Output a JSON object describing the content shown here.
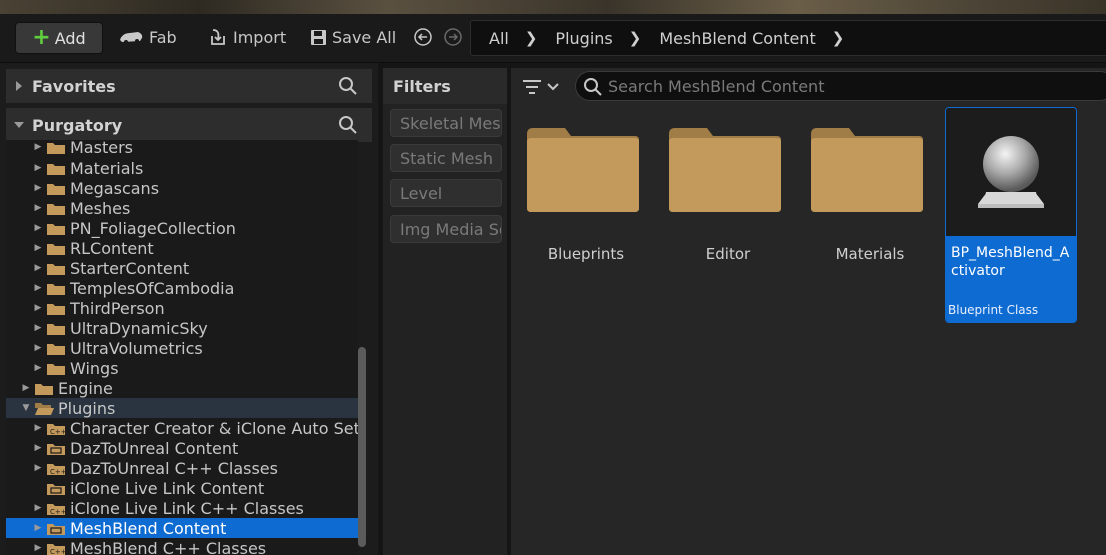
{
  "toolbar": {
    "add_label": "Add",
    "fab_label": "Fab",
    "import_label": "Import",
    "save_all_label": "Save All"
  },
  "breadcrumb": [
    "All",
    "Plugins",
    "MeshBlend Content"
  ],
  "sections": {
    "favorites": "Favorites",
    "project": "Purgatory"
  },
  "tree": [
    {
      "label": "Masters",
      "level": 2,
      "type": "folder"
    },
    {
      "label": "Materials",
      "level": 2,
      "type": "folder"
    },
    {
      "label": "Megascans",
      "level": 2,
      "type": "folder"
    },
    {
      "label": "Meshes",
      "level": 2,
      "type": "folder"
    },
    {
      "label": "PN_FoliageCollection",
      "level": 2,
      "type": "folder"
    },
    {
      "label": "RLContent",
      "level": 2,
      "type": "folder"
    },
    {
      "label": "StarterContent",
      "level": 2,
      "type": "folder"
    },
    {
      "label": "TemplesOfCambodia",
      "level": 2,
      "type": "folder"
    },
    {
      "label": "ThirdPerson",
      "level": 2,
      "type": "folder"
    },
    {
      "label": "UltraDynamicSky",
      "level": 2,
      "type": "folder"
    },
    {
      "label": "UltraVolumetrics",
      "level": 2,
      "type": "folder"
    },
    {
      "label": "Wings",
      "level": 2,
      "type": "folder"
    },
    {
      "label": "Engine",
      "level": 1,
      "type": "folder"
    },
    {
      "label": "Plugins",
      "level": 1,
      "type": "open-folder"
    },
    {
      "label": "Character Creator & iClone Auto Setup",
      "level": 2,
      "type": "cpp"
    },
    {
      "label": "DazToUnreal Content",
      "level": 2,
      "type": "content"
    },
    {
      "label": "DazToUnreal C++ Classes",
      "level": 2,
      "type": "cpp"
    },
    {
      "label": "iClone Live Link Content",
      "level": 2,
      "type": "content"
    },
    {
      "label": "iClone Live Link C++ Classes",
      "level": 2,
      "type": "cpp"
    },
    {
      "label": "MeshBlend Content",
      "level": 2,
      "type": "content"
    },
    {
      "label": "MeshBlend C++ Classes",
      "level": 2,
      "type": "cpp"
    }
  ],
  "filters": {
    "title": "Filters",
    "chips": [
      "Skeletal Mesh",
      "Static Mesh",
      "Level",
      "Img Media Source"
    ]
  },
  "search": {
    "placeholder": "Search MeshBlend Content"
  },
  "folders": [
    "Blueprints",
    "Editor",
    "Materials"
  ],
  "asset": {
    "name": "BP_MeshBlend_Activator",
    "type": "Blueprint Class"
  },
  "colors": {
    "selection": "#0e6bd1",
    "folder": "#c49a5c",
    "add_plus": "#5fcf3f"
  }
}
